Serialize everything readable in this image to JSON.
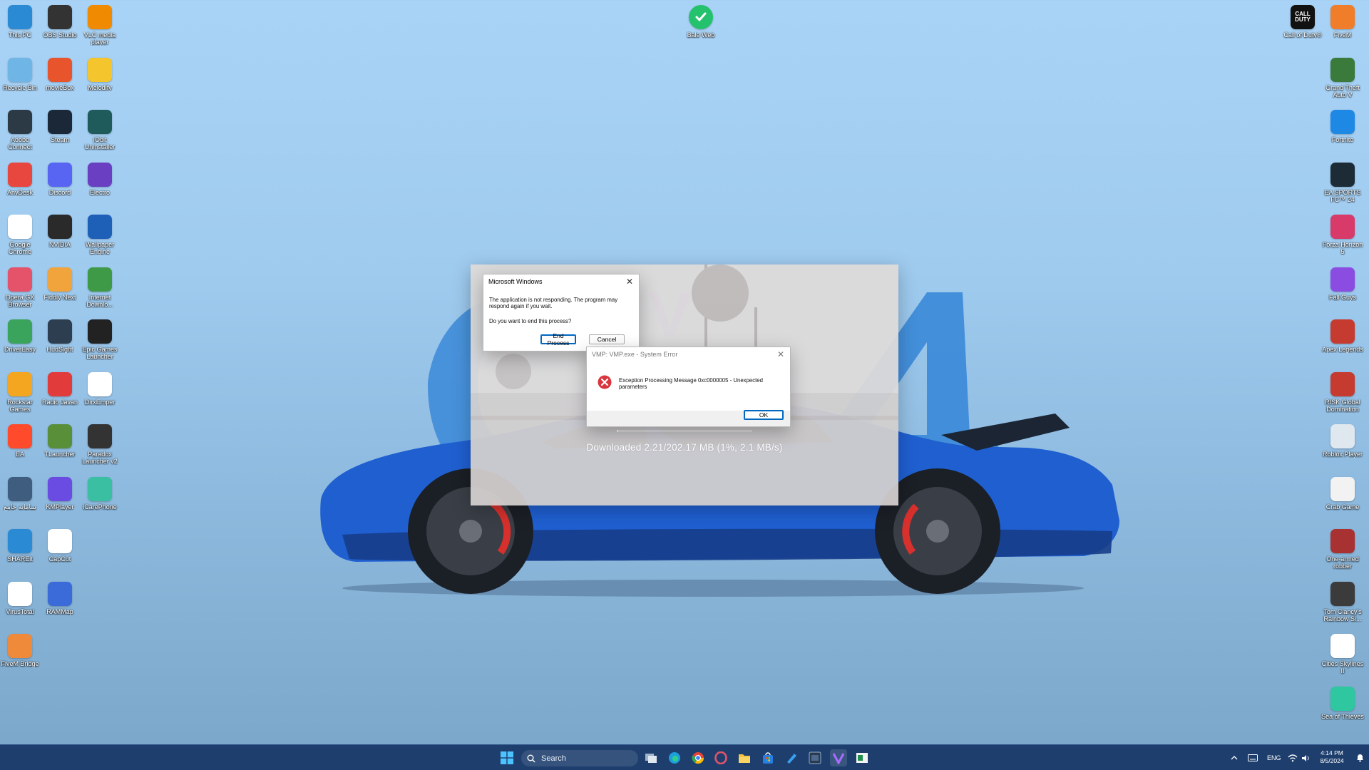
{
  "desktop": {
    "left_icons": [
      [
        {
          "label": "This PC",
          "icon": "monitor-icon",
          "color": "#2a8ad4"
        },
        {
          "label": "Recycle Bin",
          "icon": "recycle-bin-icon",
          "color": "#6fb6e6"
        },
        {
          "label": "Adobe Connect",
          "icon": "adobe-connect-icon",
          "color": "#2b3a45"
        },
        {
          "label": "AnyDesk",
          "icon": "anydesk-icon",
          "color": "#e8473f"
        },
        {
          "label": "Google Chrome",
          "icon": "chrome-icon",
          "color": "#ffffff"
        },
        {
          "label": "Opera GX Browser",
          "icon": "opera-gx-icon",
          "color": "#e4536a"
        },
        {
          "label": "DriverEasy",
          "icon": "drivereasy-icon",
          "color": "#3aa35c"
        },
        {
          "label": "Rockstar Games",
          "icon": "rockstar-icon",
          "color": "#f4a620"
        },
        {
          "label": "EA",
          "icon": "ea-icon",
          "color": "#ff4b2b"
        },
        {
          "label": "سامانه جامع",
          "icon": "app-icon",
          "color": "#3f5d7e"
        },
        {
          "label": "SHAREit",
          "icon": "shareit-icon",
          "color": "#2a8ad4"
        },
        {
          "label": "VirusTotal",
          "icon": "virustotal-icon",
          "color": "#ffffff"
        },
        {
          "label": "FiveM Bridge",
          "icon": "fivem-bridge-icon",
          "color": "#f08a3b"
        }
      ],
      [
        {
          "label": "OBS Studio",
          "icon": "obs-icon",
          "color": "#333333"
        },
        {
          "label": "movieBox",
          "icon": "moviebox-icon",
          "color": "#e8542b"
        },
        {
          "label": "Steam",
          "icon": "steam-icon",
          "color": "#1b2838"
        },
        {
          "label": "Discord",
          "icon": "discord-icon",
          "color": "#5865f2"
        },
        {
          "label": "NVIDIA",
          "icon": "nvidia-icon",
          "color": "#2a2a2a"
        },
        {
          "label": "Fiddly Next",
          "icon": "fiddly-icon",
          "color": "#f1a33c"
        },
        {
          "label": "HudSight",
          "icon": "hudsight-icon",
          "color": "#2d3e50"
        },
        {
          "label": "Radio Javan",
          "icon": "radio-javan-icon",
          "color": "#e23b3b"
        },
        {
          "label": "TLauncher",
          "icon": "tlauncher-icon",
          "color": "#5a8f3a"
        },
        {
          "label": "KMPlayer",
          "icon": "kmplayer-icon",
          "color": "#6b4ce2"
        },
        {
          "label": "CapCut",
          "icon": "capcut-icon",
          "color": "#ffffff"
        },
        {
          "label": "RAMMap",
          "icon": "rammap-icon",
          "color": "#3a6bd8"
        }
      ],
      [
        {
          "label": "VLC media player",
          "icon": "vlc-icon",
          "color": "#f08a00"
        },
        {
          "label": "Melodify",
          "icon": "melodify-icon",
          "color": "#f4c52c"
        },
        {
          "label": "IObit Uninstaller",
          "icon": "iobit-icon",
          "color": "#1f5b5b"
        },
        {
          "label": "Electro",
          "icon": "electro-icon",
          "color": "#6a3fc2"
        },
        {
          "label": "Wallpaper Engine",
          "icon": "wallpaper-engine-icon",
          "color": "#1e5fb8"
        },
        {
          "label": "Internet Downlo...",
          "icon": "idm-icon",
          "color": "#3f9a47"
        },
        {
          "label": "Epic Games Launcher",
          "icon": "epic-games-icon",
          "color": "#222222"
        },
        {
          "label": "DirxEmper",
          "icon": "file-icon",
          "color": "#ffffff"
        },
        {
          "label": "Paradox Launcher v2",
          "icon": "paradox-icon",
          "color": "#333333"
        },
        {
          "label": "iCarePhone",
          "icon": "icarephone-icon",
          "color": "#3bbfa3"
        }
      ]
    ],
    "top_center_icon": {
      "label": "Bale Web",
      "icon": "bale-icon",
      "color": "#25c26e"
    },
    "right_icons": [
      [
        {
          "label": "Call of Duty®",
          "icon": "call-of-duty-icon",
          "color": "#111111",
          "text": "CALL DUTY"
        }
      ],
      [
        {
          "label": "FiveM",
          "icon": "fivem-icon",
          "color": "#f07d2a"
        },
        {
          "label": "Grand Theft Auto V",
          "icon": "gta-v-icon",
          "color": "#3a7a3a"
        },
        {
          "label": "Fortnite",
          "icon": "fortnite-icon",
          "color": "#1e88e5"
        },
        {
          "label": "EA SPORTS FC™ 24",
          "icon": "ea-fc-icon",
          "color": "#1d2b36"
        },
        {
          "label": "Forza Horizon 5",
          "icon": "forza-icon",
          "color": "#d83a6a"
        },
        {
          "label": "Fall Guys",
          "icon": "fall-guys-icon",
          "color": "#8b4ce2"
        },
        {
          "label": "Apex Legends",
          "icon": "apex-icon",
          "color": "#c63b2f"
        },
        {
          "label": "RISK Global Domination",
          "icon": "risk-icon",
          "color": "#c63b2f"
        },
        {
          "label": "Roblox Player",
          "icon": "roblox-icon",
          "color": "#dfe7ef"
        },
        {
          "label": "Crab Game",
          "icon": "crab-game-icon",
          "color": "#f2f2f2"
        },
        {
          "label": "One-armed robber",
          "icon": "one-armed-robber-icon",
          "color": "#a83232"
        },
        {
          "label": "Tom Clancy's Rainbow Si...",
          "icon": "rainbow-six-icon",
          "color": "#3b3b3b"
        },
        {
          "label": "Cities Skylines II",
          "icon": "file-icon",
          "color": "#ffffff"
        },
        {
          "label": "Sea of Thieves",
          "icon": "sea-of-thieves-icon",
          "color": "#2ec7a0"
        }
      ]
    ]
  },
  "loader": {
    "status": "Downloaded 2.21/202.17 MB (1%, 2.1 MB/s)",
    "progress_percent": 1
  },
  "dialog_windows": {
    "title": "Microsoft Windows",
    "message": "The application is not responding. The program may respond again if you wait.",
    "question": "Do you want to end this process?",
    "end_label": "End Process",
    "cancel_label": "Cancel"
  },
  "dialog_vmp": {
    "title": "VMP: VMP.exe - System Error",
    "message": "Exception Processing Message 0xc0000005 - Unexpected parameters",
    "ok_label": "OK"
  },
  "taskbar": {
    "search_placeholder": "Search",
    "language": "ENG",
    "time": "4:14 PM",
    "date": "8/5/2024",
    "accent": "#0078d4"
  }
}
